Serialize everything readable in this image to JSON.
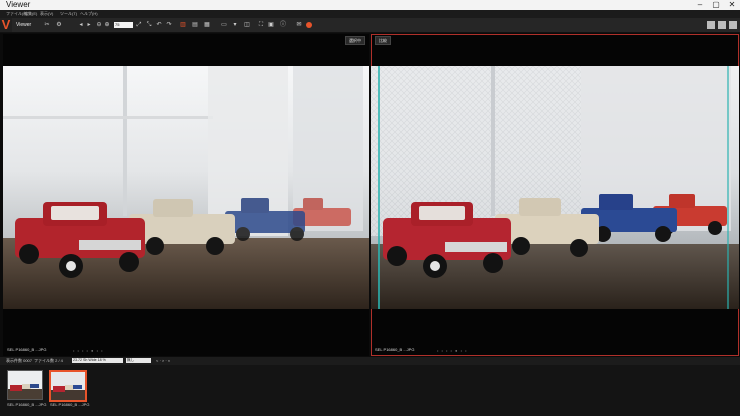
{
  "window": {
    "title": "Viewer",
    "controls": [
      "–",
      "▢",
      "✕"
    ]
  },
  "menu": [
    "ファイル(F)",
    "編集(E)",
    "表示(V)",
    "ツール(T)",
    "ヘルプ(H)"
  ],
  "toolbar": {
    "app_title": "Viewer",
    "zoom_value": "75"
  },
  "panels": {
    "left": {
      "tag": "選択中",
      "file_name": "SEL P16860_B ...JPG",
      "dots": "• • • • ● • •"
    },
    "right": {
      "tag": "比較",
      "file_name": "SEL P16860_B ...JPG",
      "dots": "• • • • ● • •"
    }
  },
  "status": {
    "display_count": "表示件数 0007",
    "file_count": "ファイル数 2 / 4",
    "info_select": "23.72 Sh Wide 18 %",
    "option_select": "無し",
    "pager": "< · > · ×"
  },
  "filmstrip": {
    "items": [
      {
        "label": "SEL P16860_B ...JPG",
        "selected": false
      },
      {
        "label": "SEL P16860_B ...JPG",
        "selected": true
      }
    ]
  },
  "colors": {
    "accent": "#e8542b",
    "panel_outline": "#b0302a"
  }
}
